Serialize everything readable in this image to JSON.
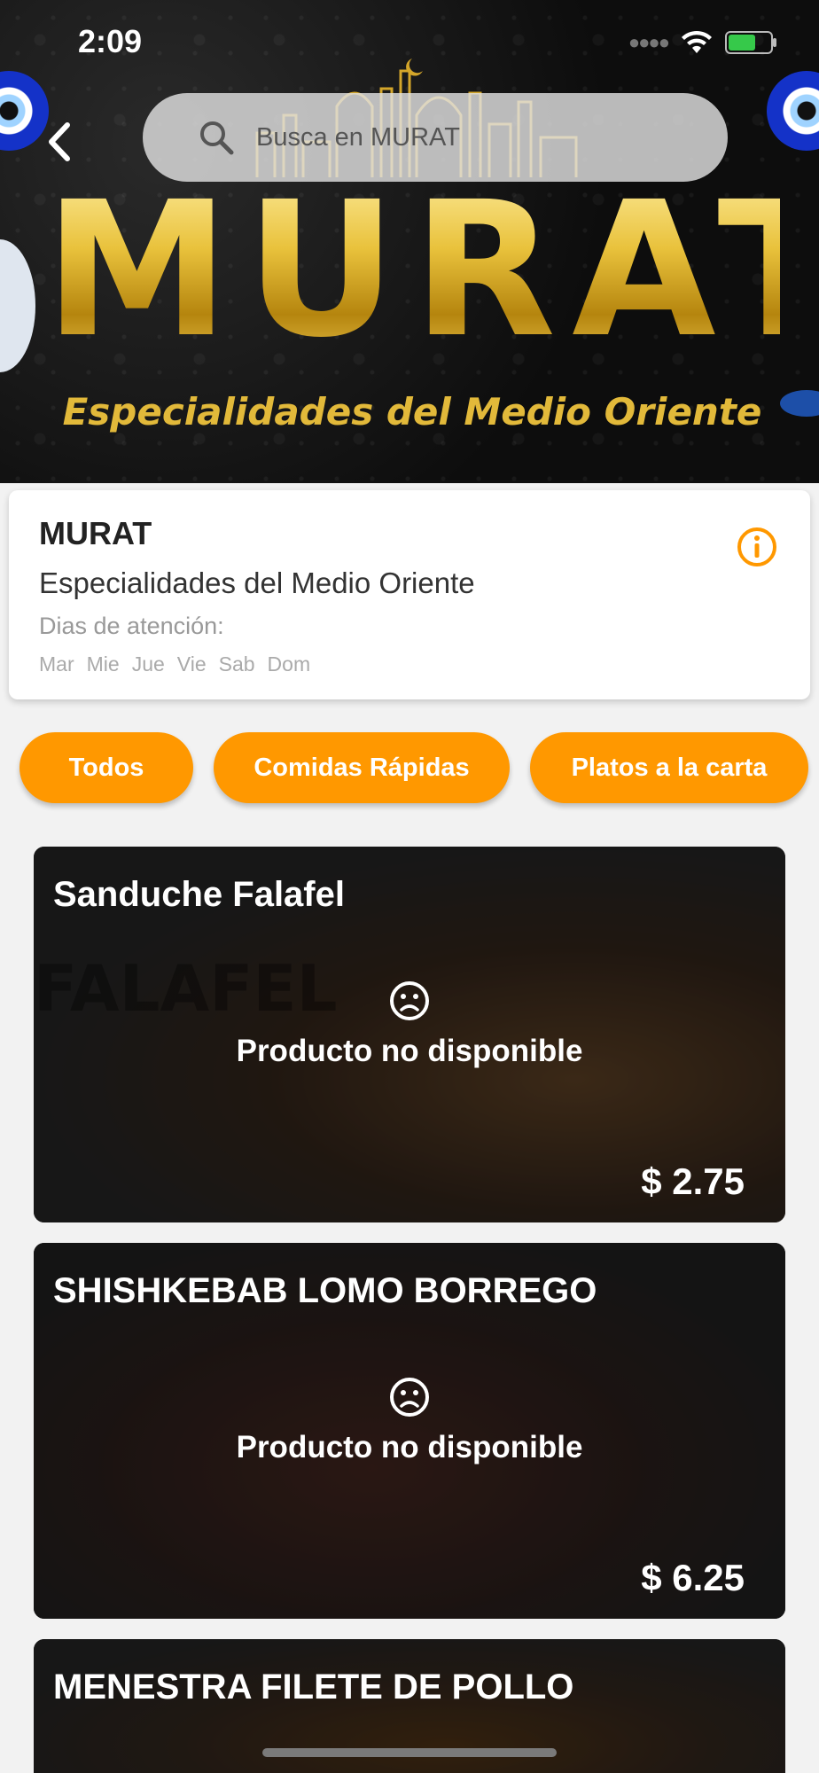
{
  "status_bar": {
    "time": "2:09"
  },
  "hero": {
    "logo_text": "MURAT",
    "tagline": "Especialidades del Medio Oriente"
  },
  "search": {
    "placeholder": "Busca en MURAT"
  },
  "restaurant": {
    "name": "MURAT",
    "description": "Especialidades del Medio Oriente",
    "days_label": "Dias de atención:",
    "days": [
      "Mar",
      "Mie",
      "Jue",
      "Vie",
      "Sab",
      "Dom"
    ]
  },
  "categories": [
    "Todos",
    "Comidas Rápidas",
    "Platos a la carta"
  ],
  "products": [
    {
      "title": "Sanduche Falafel",
      "status": "Producto no disponible",
      "price": "$ 2.75",
      "watermark": "FALAFEL"
    },
    {
      "title": "SHISHKEBAB LOMO BORREGO",
      "status": "Producto no disponible",
      "price": "$ 6.25"
    },
    {
      "title": "MENESTRA FILETE DE POLLO"
    }
  ],
  "colors": {
    "accent": "#ff9800",
    "hero_gold": "#d8ab22",
    "evil_eye_blue": "#1432c8"
  }
}
